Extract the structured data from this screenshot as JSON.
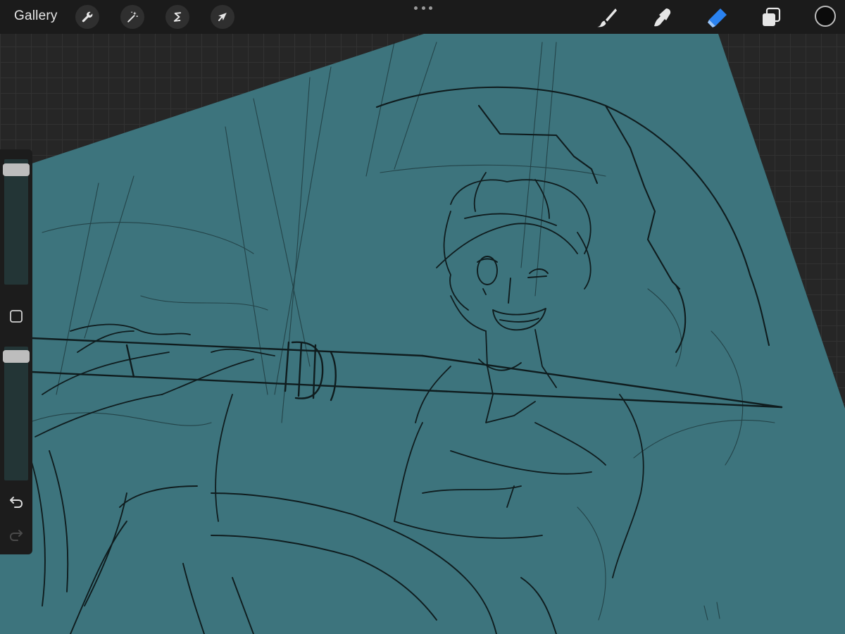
{
  "toolbar": {
    "gallery_label": "Gallery",
    "left_tools": [
      {
        "name": "actions",
        "icon": "wrench-icon"
      },
      {
        "name": "adjustments",
        "icon": "magic-wand-icon"
      },
      {
        "name": "selection",
        "icon": "selection-s-icon"
      },
      {
        "name": "transform",
        "icon": "arrow-cursor-icon"
      }
    ],
    "more_icon": "three-dots-icon",
    "right_tools": [
      {
        "name": "brush",
        "icon": "brush-icon",
        "active": false
      },
      {
        "name": "smudge",
        "icon": "smudge-finger-icon",
        "active": false
      },
      {
        "name": "eraser",
        "icon": "eraser-icon",
        "active": true
      },
      {
        "name": "layers",
        "icon": "layers-icon",
        "active": false
      }
    ],
    "current_color": "#0b0b0b"
  },
  "sidebar": {
    "brush_size": 1.0,
    "brush_opacity": 1.0,
    "modify_icon": "square-outline-icon",
    "undo_icon": "undo-arrow-icon",
    "redo_icon": "redo-arrow-icon",
    "redo_enabled": false
  },
  "canvas": {
    "background_color": "#3d747d",
    "workspace_color": "#262626",
    "sketch_color": "#0f1c1e",
    "accent_active": "#2a82f0"
  }
}
